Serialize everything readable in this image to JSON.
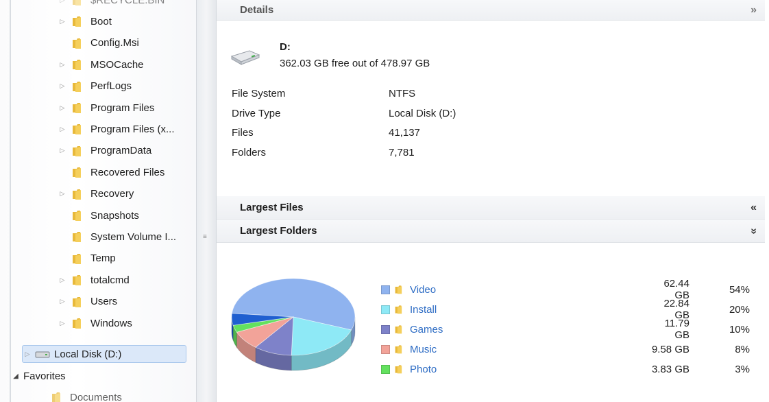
{
  "tree": {
    "items": [
      {
        "label": "$RECYCLE.BIN",
        "expandable": true
      },
      {
        "label": "Boot",
        "expandable": true
      },
      {
        "label": "Config.Msi",
        "expandable": false
      },
      {
        "label": "MSOCache",
        "expandable": true
      },
      {
        "label": "PerfLogs",
        "expandable": true
      },
      {
        "label": "Program Files",
        "expandable": true
      },
      {
        "label": "Program Files (x...",
        "expandable": true
      },
      {
        "label": "ProgramData",
        "expandable": true
      },
      {
        "label": "Recovered Files",
        "expandable": false
      },
      {
        "label": "Recovery",
        "expandable": true
      },
      {
        "label": "Snapshots",
        "expandable": false
      },
      {
        "label": "System Volume I...",
        "expandable": false
      },
      {
        "label": "Temp",
        "expandable": false
      },
      {
        "label": "totalcmd",
        "expandable": true
      },
      {
        "label": "Users",
        "expandable": true
      },
      {
        "label": "Windows",
        "expandable": true
      }
    ],
    "selected_drive": "Local Disk (D:)",
    "favorites_label": "Favorites",
    "favorites_first": "Documents",
    "folder_color": "#e8b93a"
  },
  "details": {
    "header": "Details",
    "drive_letter": "D:",
    "free_text": "362.03 GB free out of 478.97 GB",
    "properties": [
      {
        "label": "File System",
        "value": "NTFS"
      },
      {
        "label": "Drive Type",
        "value": "Local Disk (D:)"
      },
      {
        "label": "Files",
        "value": "41,137"
      },
      {
        "label": "Folders",
        "value": "7,781"
      }
    ]
  },
  "largest_files": {
    "header": "Largest Files"
  },
  "largest_folders": {
    "header": "Largest Folders",
    "items": [
      {
        "name": "Video",
        "size": "62.44 GB",
        "percent": "54%",
        "value": 54,
        "color": "#8fb3ef"
      },
      {
        "name": "Install",
        "size": "22.84 GB",
        "percent": "20%",
        "value": 20,
        "color": "#8ee9f6"
      },
      {
        "name": "Games",
        "size": "11.79 GB",
        "percent": "10%",
        "value": 10,
        "color": "#7e82c9"
      },
      {
        "name": "Music",
        "size": "9.58 GB",
        "percent": "8%",
        "value": 8,
        "color": "#f2a399"
      },
      {
        "name": "Photo",
        "size": "3.83 GB",
        "percent": "3%",
        "value": 3,
        "color": "#63e15f"
      }
    ],
    "pie_remainder_color": "#1f5fd0"
  }
}
